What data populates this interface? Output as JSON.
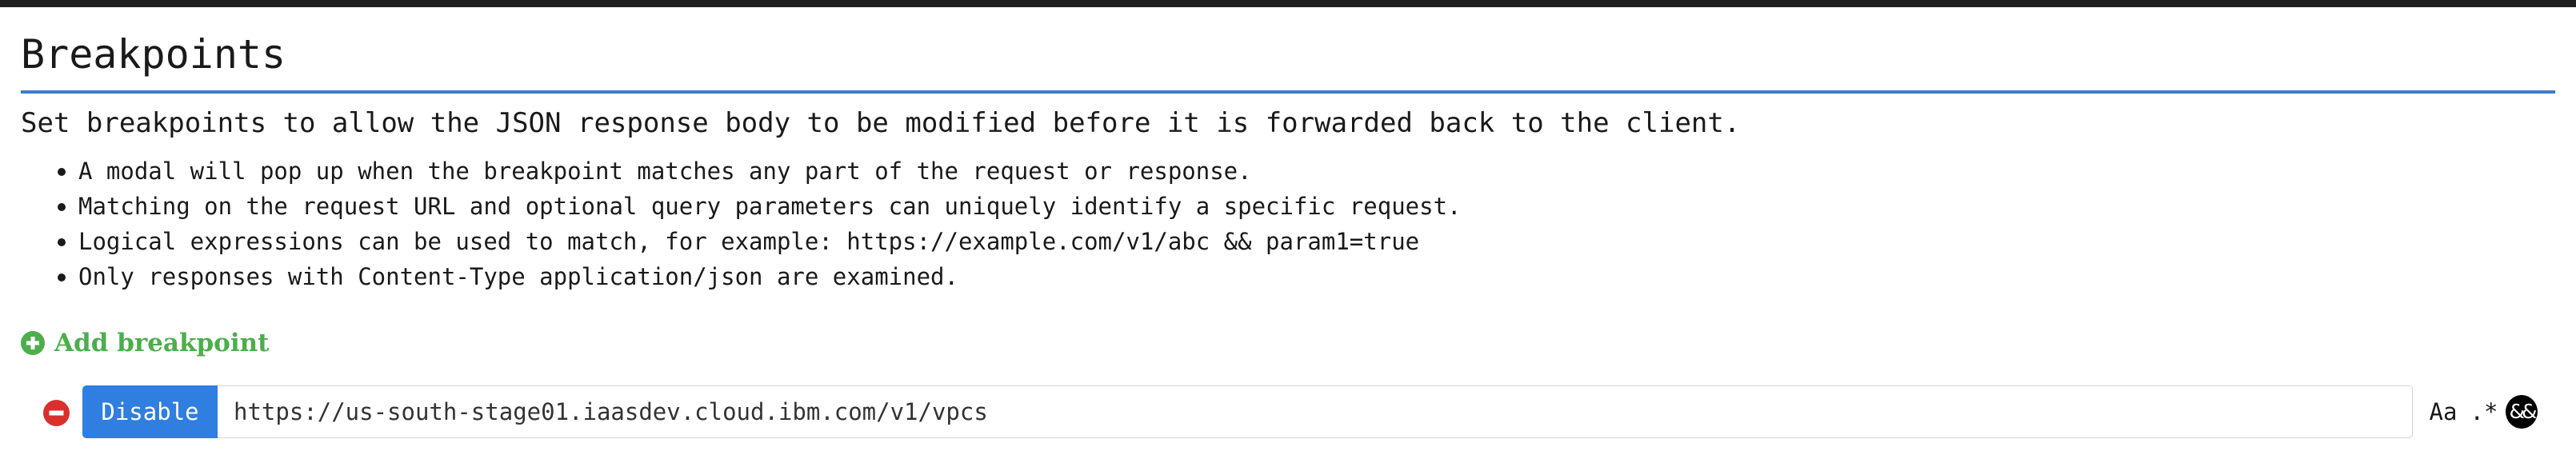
{
  "page": {
    "title": "Breakpoints",
    "intro": "Set breakpoints to allow the JSON response body to be modified before it is forwarded back to the client.",
    "bullets": [
      "A modal will pop up when the breakpoint matches any part of the request or response.",
      "Matching on the request URL and optional query parameters can uniquely identify a specific request.",
      "Logical expressions can be used to match, for example: https://example.com/v1/abc && param1=true",
      "Only responses with Content-Type application/json are examined."
    ],
    "add_label": "Add breakpoint"
  },
  "breakpoint": {
    "toggle_label": "Disable",
    "url": "https://us-south-stage01.iaasdev.cloud.ibm.com/v1/vpcs",
    "options": {
      "case": "Aa",
      "regex": ".*",
      "logical": "&&"
    }
  },
  "icons": {
    "add": "plus-circle-icon",
    "remove": "minus-circle-icon"
  },
  "colors": {
    "accent": "#2f7ee0",
    "rule": "#3d7cc9",
    "add_green": "#4cae4c",
    "remove_red": "#d9302c"
  }
}
